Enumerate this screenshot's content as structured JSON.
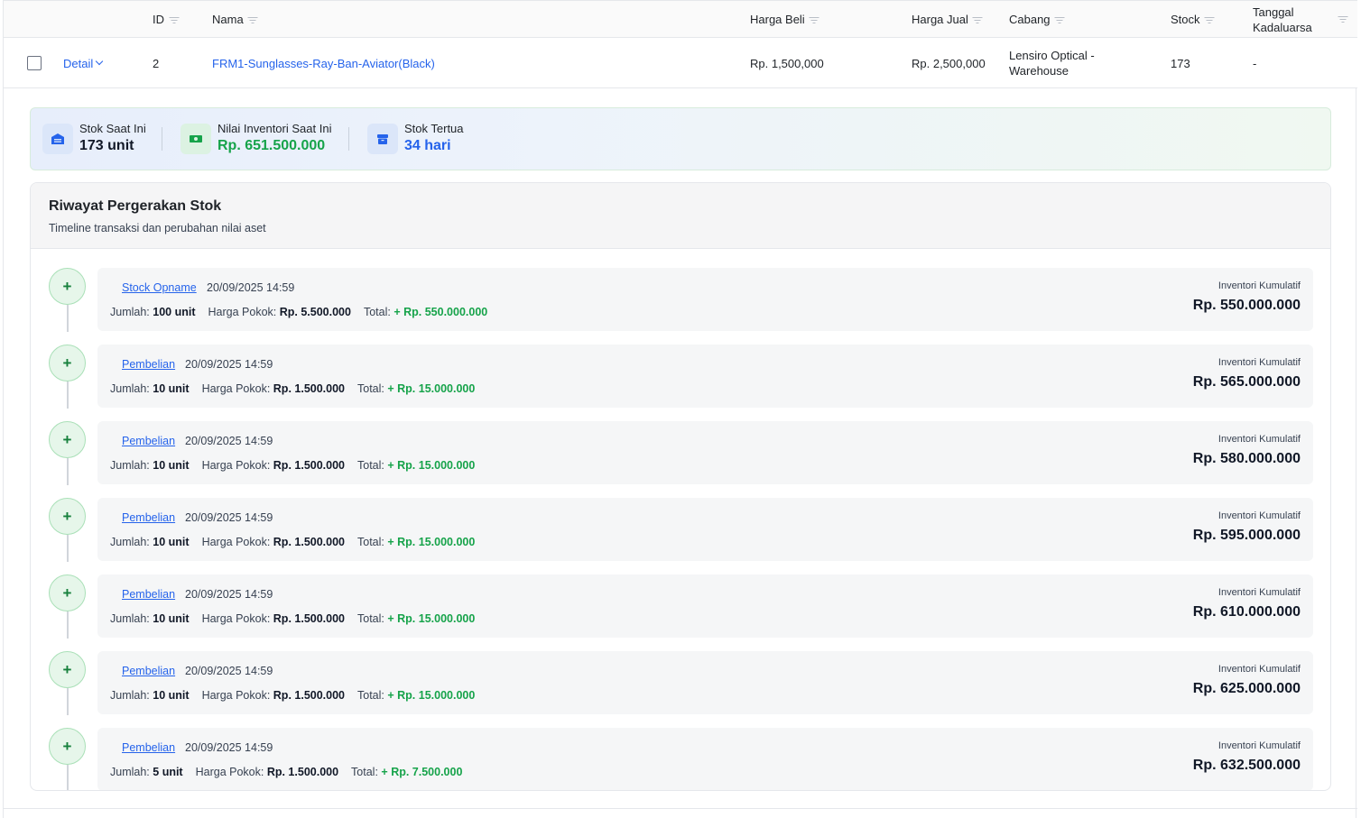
{
  "table": {
    "headers": {
      "id": "ID",
      "nama": "Nama",
      "harga_beli": "Harga Beli",
      "harga_jual": "Harga Jual",
      "cabang": "Cabang",
      "stock": "Stock",
      "tanggal_kadaluarsa": "Tanggal Kadaluarsa"
    },
    "row": {
      "detail_label": "Detail",
      "id": "2",
      "nama": "FRM1-Sunglasses-Ray-Ban-Aviator(Black)",
      "harga_beli": "Rp. 1,500,000",
      "harga_jual": "Rp. 2,500,000",
      "cabang": "Lensiro Optical - Warehouse",
      "stock": "173",
      "tanggal_kadaluarsa": "-"
    }
  },
  "summary": {
    "stok_label": "Stok Saat Ini",
    "stok_value": "173 unit",
    "nilai_label": "Nilai Inventori Saat Ini",
    "nilai_value": "Rp. 651.500.000",
    "tertua_label": "Stok Tertua",
    "tertua_value": "34 hari",
    "colors": {
      "nilai": "#16a34a",
      "tertua": "#2563eb"
    }
  },
  "history": {
    "title": "Riwayat Pergerakan Stok",
    "subtitle": "Timeline transaksi dan perubahan nilai aset",
    "labels": {
      "jumlah": "Jumlah:",
      "harga_pokok": "Harga Pokok:",
      "total": "Total:",
      "kumulatif": "Inventori Kumulatif"
    },
    "items": [
      {
        "type": "Stock Opname",
        "date": "20/09/2025 14:59",
        "jumlah": "100 unit",
        "harga_pokok": "Rp. 5.500.000",
        "total": "+ Rp. 550.000.000",
        "kumulatif": "Rp. 550.000.000"
      },
      {
        "type": "Pembelian",
        "date": "20/09/2025 14:59",
        "jumlah": "10 unit",
        "harga_pokok": "Rp. 1.500.000",
        "total": "+ Rp. 15.000.000",
        "kumulatif": "Rp. 565.000.000"
      },
      {
        "type": "Pembelian",
        "date": "20/09/2025 14:59",
        "jumlah": "10 unit",
        "harga_pokok": "Rp. 1.500.000",
        "total": "+ Rp. 15.000.000",
        "kumulatif": "Rp. 580.000.000"
      },
      {
        "type": "Pembelian",
        "date": "20/09/2025 14:59",
        "jumlah": "10 unit",
        "harga_pokok": "Rp. 1.500.000",
        "total": "+ Rp. 15.000.000",
        "kumulatif": "Rp. 595.000.000"
      },
      {
        "type": "Pembelian",
        "date": "20/09/2025 14:59",
        "jumlah": "10 unit",
        "harga_pokok": "Rp. 1.500.000",
        "total": "+ Rp. 15.000.000",
        "kumulatif": "Rp. 610.000.000"
      },
      {
        "type": "Pembelian",
        "date": "20/09/2025 14:59",
        "jumlah": "10 unit",
        "harga_pokok": "Rp. 1.500.000",
        "total": "+ Rp. 15.000.000",
        "kumulatif": "Rp. 625.000.000"
      },
      {
        "type": "Pembelian",
        "date": "20/09/2025 14:59",
        "jumlah": "5 unit",
        "harga_pokok": "Rp. 1.500.000",
        "total": "+ Rp. 7.500.000",
        "kumulatif": "Rp. 632.500.000"
      }
    ]
  }
}
